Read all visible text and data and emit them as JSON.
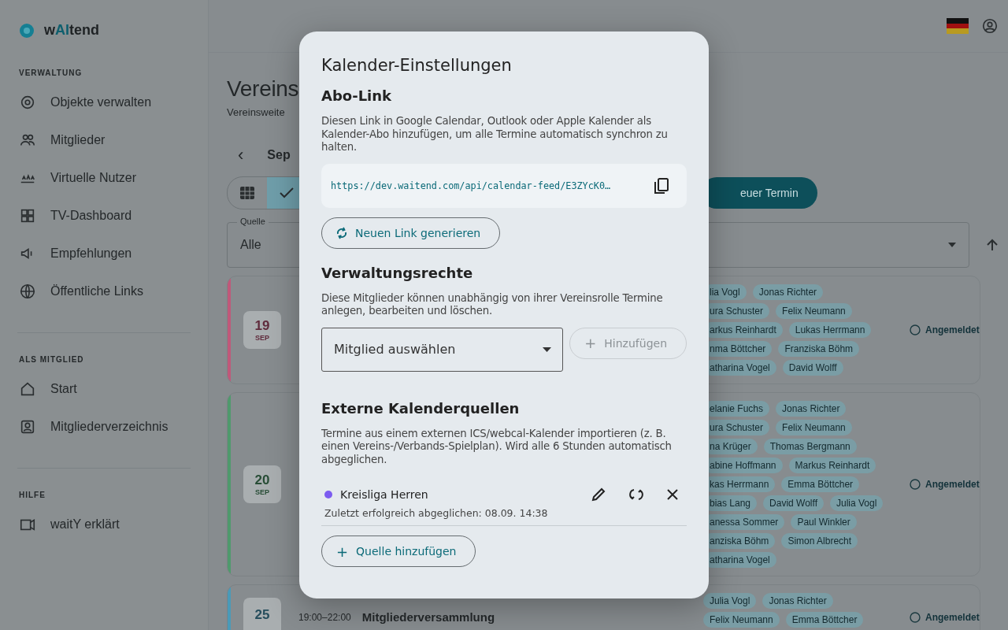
{
  "sidebar": {
    "logo": [
      {
        "text": "w",
        "accent": false
      },
      {
        "text": "AI",
        "accent": true
      },
      {
        "text": "tend",
        "accent": false
      }
    ],
    "sections": [
      {
        "title": "VERWALTUNG",
        "items": [
          {
            "label": "Objekte verwalten"
          },
          {
            "label": "Mitglieder"
          },
          {
            "label": "Virtuelle Nutzer"
          },
          {
            "label": "TV-Dashboard"
          },
          {
            "label": "Empfehlungen"
          },
          {
            "label": "Öffentliche Links"
          }
        ]
      },
      {
        "title": "ALS MITGLIED",
        "items": [
          {
            "label": "Start"
          },
          {
            "label": "Mitgliederverzeichnis"
          }
        ]
      },
      {
        "title": "HILFE",
        "items": [
          {
            "label": "waitY erklärt"
          }
        ]
      }
    ]
  },
  "page": {
    "title": "Vereins",
    "subtitle": "Vereinsweite",
    "prev": "‹",
    "month": "Sep",
    "view_toggle": [
      {
        "selected": false
      },
      {
        "selected": true
      }
    ],
    "new_event_button": "euer Termin",
    "filter": {
      "label": "Quelle",
      "value": "Alle"
    },
    "events": [
      {
        "day": "19",
        "month": "SEP",
        "color": "#c0587a",
        "status": "Angemeldet",
        "chips": [
          [
            "lia Vogl",
            "Jonas Richter"
          ],
          [
            "ura Schuster",
            "Felix Neumann"
          ],
          [
            "arkus Reinhardt",
            "Lukas Herrmann"
          ],
          [
            "nma Böttcher",
            "Franziska Böhm"
          ],
          [
            "atharina Vogel",
            "David Wolff"
          ]
        ]
      },
      {
        "day": "20",
        "month": "SEP",
        "color": "#4f9a6c",
        "status": "Angemeldet",
        "chips": [
          [
            "elanie Fuchs",
            "Jonas Richter"
          ],
          [
            "ura Schuster",
            "Felix Neumann"
          ],
          [
            "na Krüger",
            "Thomas Bergmann"
          ],
          [
            "abine Hoffmann",
            "Markus Reinhardt"
          ],
          [
            "kas Herrmann",
            "Emma Böttcher"
          ],
          [
            "bias Lang",
            "David Wolff",
            "Julia Vogl"
          ],
          [
            "anessa Sommer",
            "Paul Winkler"
          ],
          [
            "anziska Böhm",
            "Simon Albrecht"
          ],
          [
            "atharina Vogel"
          ]
        ]
      },
      {
        "day": "25",
        "color": "#4a9ab8",
        "time": "19:00–22:00",
        "title": "Mitgliederversammlung",
        "status": "Angemeldet",
        "chips": [
          [
            "Julia Vogl",
            "Jonas Richter"
          ],
          [
            "Felix Neumann",
            "Emma Böttcher"
          ]
        ]
      }
    ]
  },
  "dialog": {
    "title": "Kalender-Einstellungen",
    "subscription": {
      "heading": "Abo-Link",
      "description": "Diesen Link in Google Calendar, Outlook oder Apple Kalender als Kalender-Abo hinzufügen, um alle Termine automatisch synchron zu halten.",
      "url": "https://dev.waitend.com/api/calendar-feed/E3ZYcK0…",
      "regenerate_button": "Neuen Link generieren"
    },
    "admin_rights": {
      "heading": "Verwaltungsrechte",
      "description": "Diese Mitglieder können unabhängig von ihrer Vereinsrolle Termine anlegen, bearbeiten und löschen.",
      "member_select": "Mitglied auswählen",
      "add_button": {
        "icon": "+",
        "label": "Hinzufügen",
        "disabled": true
      }
    },
    "external_sources": {
      "heading": "Externe Kalenderquellen",
      "description": "Termine aus einem externen ICS/webcal-Kalender importieren (z. B. einen Vereins-/Verbands-Spielplan). Wird alle 6 Stunden automatisch abgeglichen.",
      "sources": [
        {
          "name": "Kreisliga Herren",
          "color": "#7c5cf0",
          "last_sync": "Zuletzt erfolgreich abgeglichen: 08.09. 14:38"
        }
      ],
      "add_button": {
        "icon": "+",
        "label": "Quelle hinzufügen"
      }
    }
  }
}
